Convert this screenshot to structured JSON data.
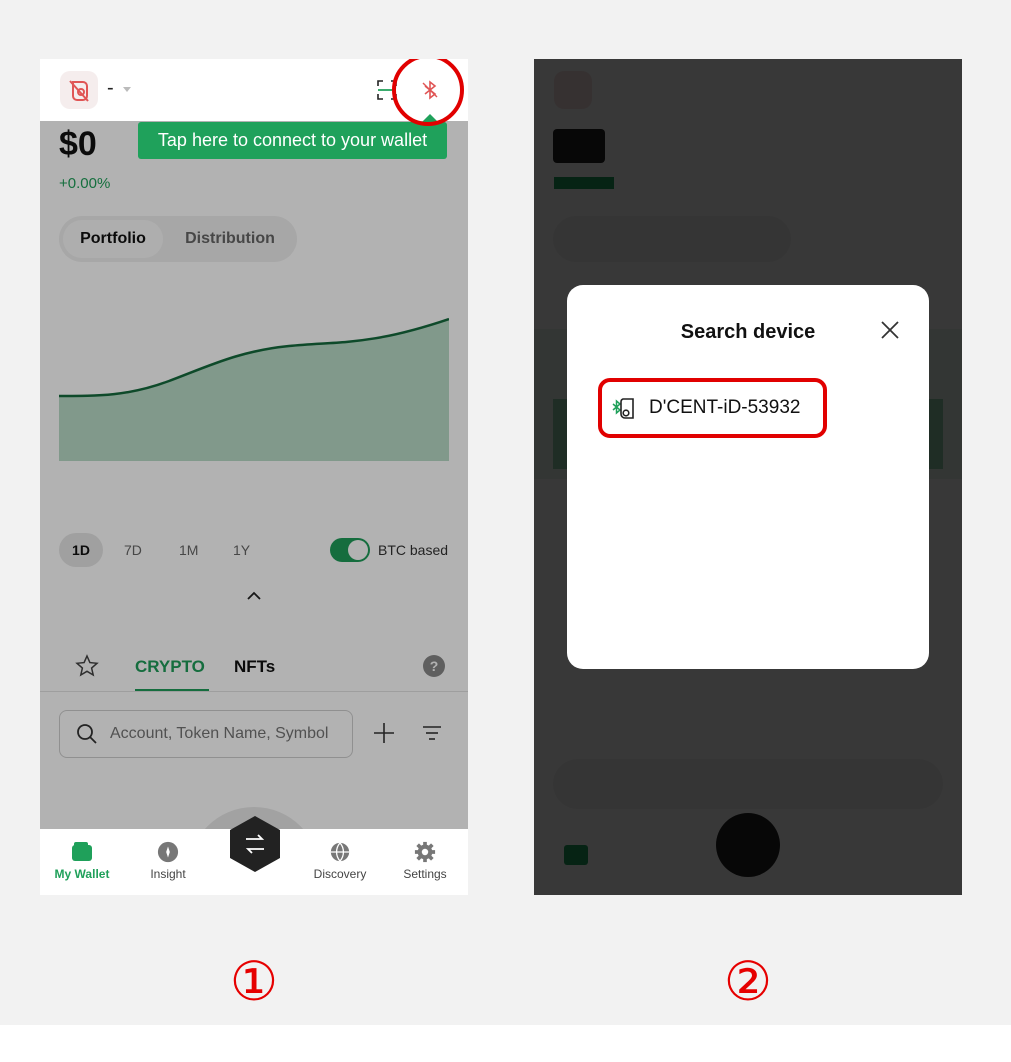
{
  "screen1": {
    "wallet_name": "-",
    "balance": "$0",
    "change": "+0.00%",
    "segments": [
      "Portfolio",
      "Distribution"
    ],
    "tooltip": "Tap here to connect to your wallet",
    "ranges": [
      "1D",
      "7D",
      "1M",
      "1Y"
    ],
    "btc_toggle_label": "BTC based",
    "tabs": {
      "crypto": "CRYPTO",
      "nfts": "NFTs"
    },
    "help": "?",
    "search": {
      "placeholder": "Account, Token Name, Symbol"
    },
    "nav": [
      {
        "label": "My Wallet",
        "icon": "wallet-icon"
      },
      {
        "label": "Insight",
        "icon": "compass-icon"
      },
      {
        "label": "",
        "icon": "swap-icon"
      },
      {
        "label": "Discovery",
        "icon": "globe-icon"
      },
      {
        "label": "Settings",
        "icon": "gear-icon"
      }
    ],
    "step_label": "①"
  },
  "screen2": {
    "modal_title": "Search device",
    "device_name": "D'CENT-iD-53932",
    "step_label": "②"
  },
  "colors": {
    "accent": "#1fa05a",
    "highlight": "#e10000",
    "bluetooth_off": "#e05555"
  }
}
